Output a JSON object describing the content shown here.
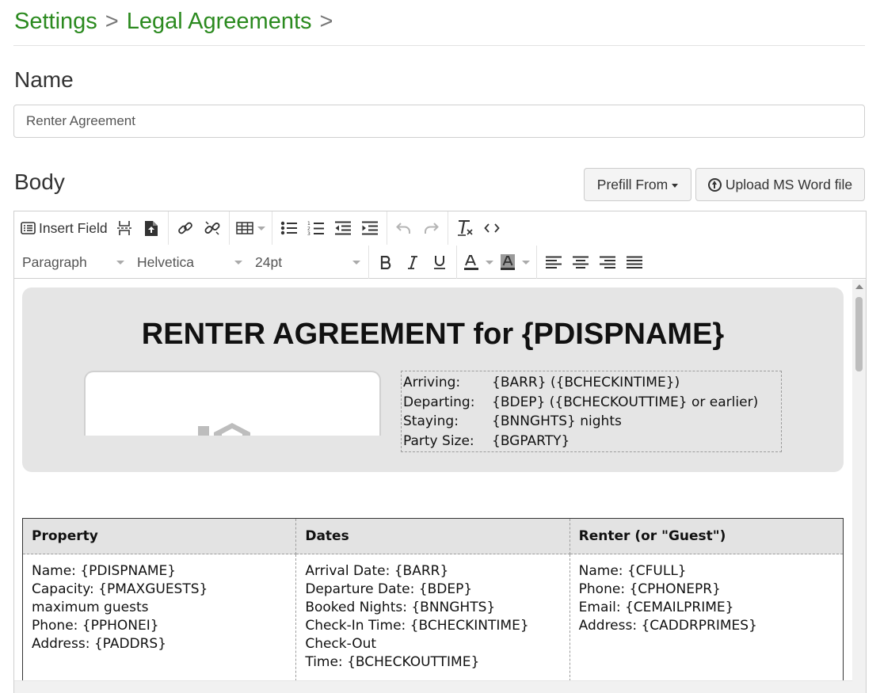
{
  "breadcrumb": {
    "items": [
      "Settings",
      "Legal Agreements"
    ],
    "separator": ">"
  },
  "name_section": {
    "label": "Name",
    "value": "Renter Agreement"
  },
  "body_section": {
    "label": "Body",
    "prefill_button": "Prefill From",
    "upload_button": "Upload MS Word file"
  },
  "toolbar": {
    "insert_field": "Insert Field",
    "block_format": "Paragraph",
    "font_family": "Helvetica",
    "font_size": "24pt"
  },
  "document": {
    "title": "RENTER AGREEMENT for {PDISPNAME}",
    "info": [
      {
        "key": "Arriving:",
        "value": "{BARR} ({BCHECKINTIME})"
      },
      {
        "key": "Departing:",
        "value": "{BDEP} ({BCHECKOUTTIME} or earlier)"
      },
      {
        "key": "Staying:",
        "value": "{BNNGHTS} nights"
      },
      {
        "key": "Party Size:",
        "value": "{BGPARTY}"
      }
    ],
    "table": {
      "headers": [
        "Property",
        "Dates",
        "Renter (or \"Guest\")"
      ],
      "columns": [
        [
          "Name: {PDISPNAME}",
          "Capacity: {PMAXGUESTS}",
          "maximum guests",
          "Phone: {PPHONEI}",
          "Address: {PADDRS}"
        ],
        [
          "Arrival Date: {BARR}",
          "Departure Date: {BDEP}",
          "Booked Nights: {BNNGHTS}",
          "Check-In Time: {BCHECKINTIME}",
          "Check-Out",
          "Time: {BCHECKOUTTIME}"
        ],
        [
          "Name: {CFULL}",
          "Phone: {CPHONEPR}",
          "Email: {CEMAILPRIME}",
          "Address: {CADDRPRIMES}"
        ]
      ]
    }
  },
  "colors": {
    "breadcrumb_link": "#2b8a1f",
    "banner_bg": "#e5e5e5",
    "table_header_bg": "#e3e3e3"
  },
  "icons": [
    "list-icon",
    "page-break-icon",
    "file-upload-icon",
    "link-icon",
    "unlink-icon",
    "table-icon",
    "bullet-list-icon",
    "numbered-list-icon",
    "outdent-icon",
    "indent-icon",
    "undo-icon",
    "redo-icon",
    "clear-format-icon",
    "code-icon",
    "bold-icon",
    "italic-icon",
    "underline-icon",
    "text-color-icon",
    "highlight-icon",
    "align-left-icon",
    "align-center-icon",
    "align-right-icon",
    "align-justify-icon",
    "upload-circle-icon",
    "home-icon"
  ]
}
